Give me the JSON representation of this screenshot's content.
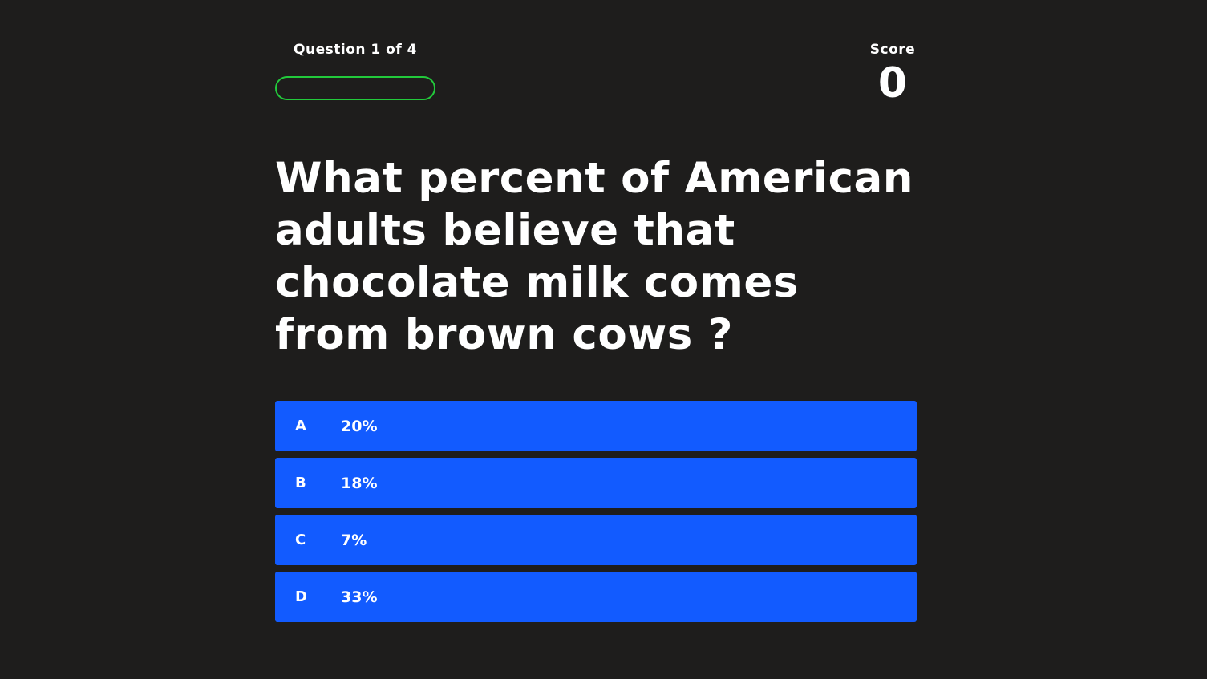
{
  "progress": {
    "label": "Question 1 of 4",
    "fraction": 0,
    "color": "#22c93b"
  },
  "score": {
    "label": "Score",
    "value": "0"
  },
  "question": {
    "text": "What percent of American adults believe that chocolate milk comes from brown cows ?"
  },
  "answers": [
    {
      "letter": "A",
      "text": "20%"
    },
    {
      "letter": "B",
      "text": "18%"
    },
    {
      "letter": "C",
      "text": "7%"
    },
    {
      "letter": "D",
      "text": "33%"
    }
  ],
  "colors": {
    "background": "#1e1d1c",
    "answer": "#125bff",
    "text": "#ffffff"
  }
}
